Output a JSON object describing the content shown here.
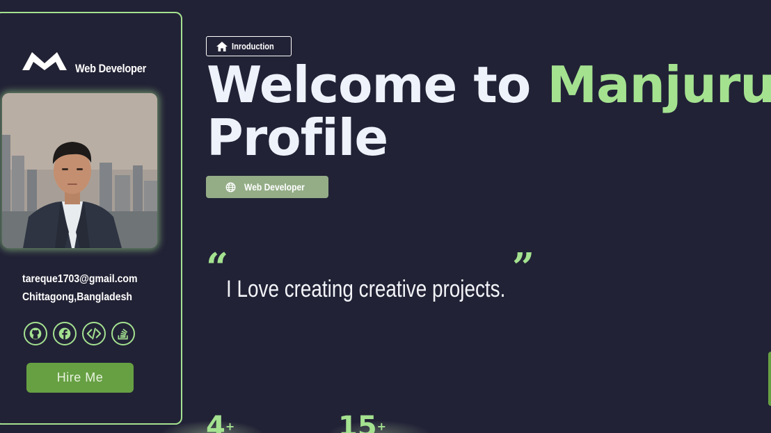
{
  "sidebar": {
    "brand_role": "Web Developer",
    "email": "tareque1703@gmail.com",
    "location": "Chittagong,Bangladesh",
    "socials": [
      "github-icon",
      "facebook-icon",
      "code-icon",
      "stackoverflow-icon"
    ],
    "hire_label": "Hire Me"
  },
  "main": {
    "intro_badge": "Inroduction",
    "headline_pre": "Welcome to ",
    "headline_name": "Manjurul Alam's",
    "headline_post": " Profile",
    "role_badge": "Web Developer",
    "quote_open": "“",
    "quote_text": "I Love creating creative projects.",
    "quote_close": "”",
    "stats": [
      {
        "value": "4",
        "suffix": "+"
      },
      {
        "value": "15",
        "suffix": "+"
      }
    ]
  },
  "colors": {
    "background": "#222236",
    "accent": "#a4e290",
    "button": "#67a043",
    "role_badge": "#94ad87"
  }
}
